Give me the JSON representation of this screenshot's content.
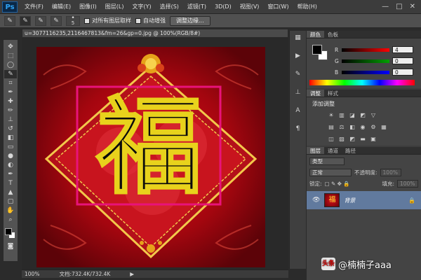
{
  "app": {
    "logo": "Ps"
  },
  "menu": [
    "文件(F)",
    "编辑(E)",
    "图像(I)",
    "图层(L)",
    "文字(Y)",
    "选择(S)",
    "滤镜(T)",
    "3D(D)",
    "视图(V)",
    "窗口(W)",
    "帮助(H)"
  ],
  "window_controls": {
    "minimize": "—",
    "restore": "□",
    "close": "✕"
  },
  "options": {
    "brush_size": "5",
    "sample_all_label": "对所有图层取样",
    "auto_enhance_label": "自动增强",
    "refine_edge_label": "调整边缘..."
  },
  "document": {
    "tab_title": "u=3077116235,2116467813&fm=26&gp=0.jpg @ 100%(RGB/8#)",
    "status_zoom": "100%",
    "status_doc": "文档:732.4K/732.4K",
    "main_char": "福"
  },
  "color_panel": {
    "tabs": [
      "颜色",
      "色板"
    ],
    "r_label": "R",
    "r_value": "4",
    "g_label": "G",
    "g_value": "0",
    "b_label": "B",
    "b_value": "0",
    "colors": {
      "r_track": "#ff0000",
      "g_track": "#00a000",
      "b_track": "#0000ff"
    }
  },
  "adjustments_panel": {
    "tabs": [
      "调整",
      "样式"
    ],
    "title": "添加调整"
  },
  "layers_panel": {
    "tabs": [
      "图层",
      "通道",
      "路径"
    ],
    "filter_label": "类型",
    "blend_mode": "正常",
    "opacity_label": "不透明度:",
    "opacity_value": "100%",
    "lock_label": "锁定:",
    "fill_label": "填充:",
    "fill_value": "100%",
    "layer_name": "背景"
  },
  "watermark": {
    "logo": "头条",
    "text": "@楠楠子aaa"
  },
  "icons": {
    "visibility": "eye-icon",
    "lock": "lock-icon"
  }
}
